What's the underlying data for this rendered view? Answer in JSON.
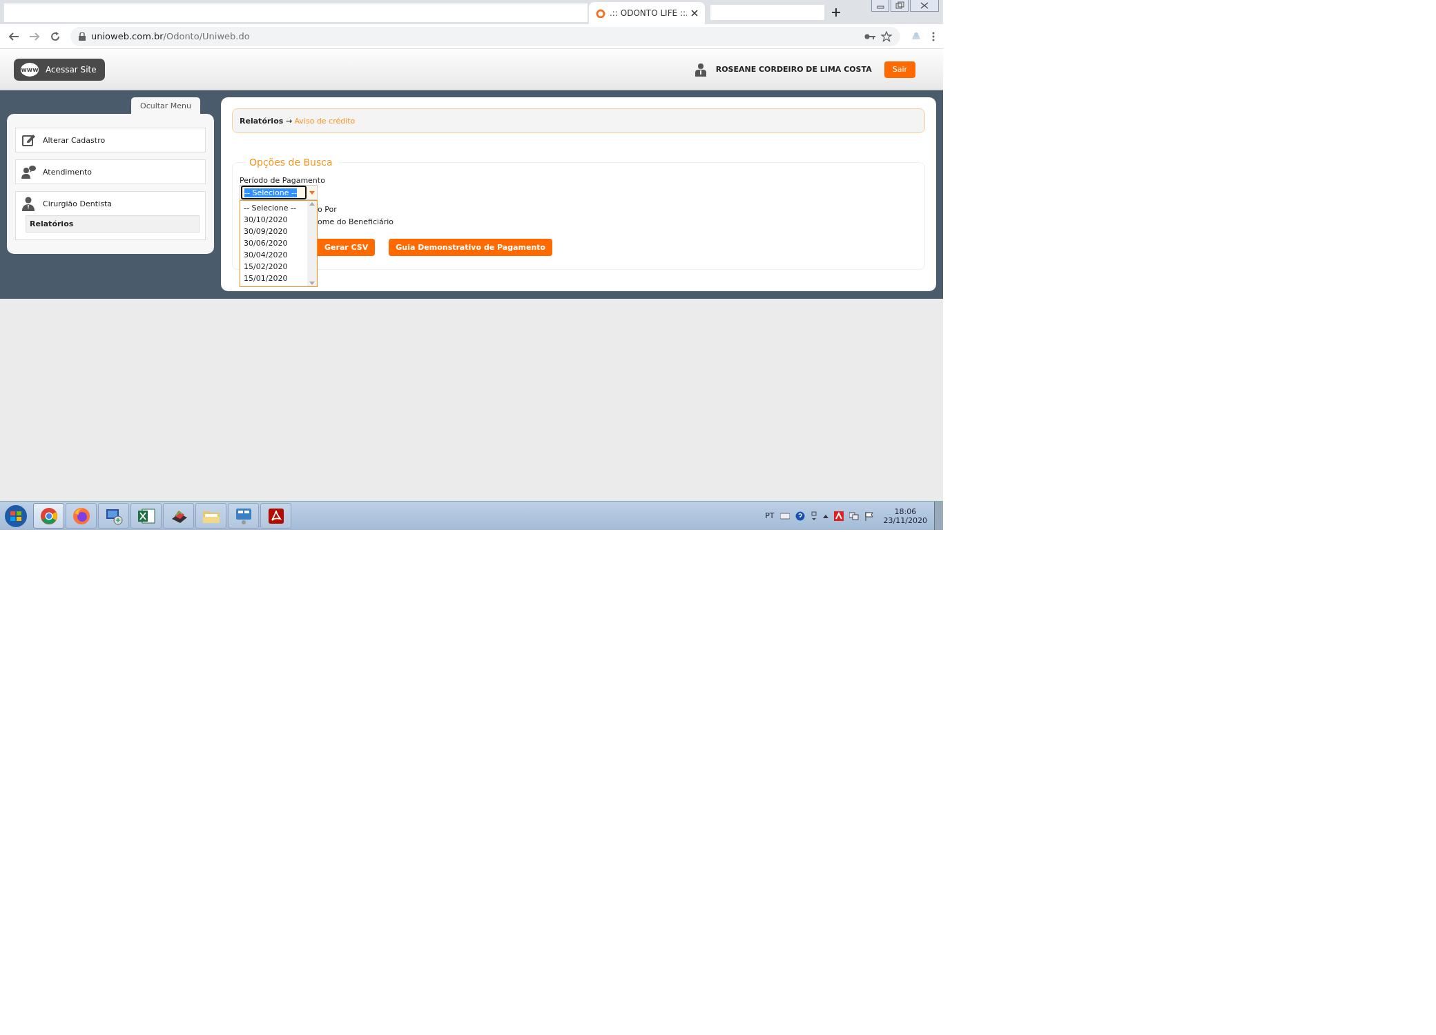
{
  "browser": {
    "tab_title": ".:: ODONTO LIFE ::.",
    "url_domain": "unioweb.com.br",
    "url_path": "/Odonto/Uniweb.do"
  },
  "header": {
    "www_badge": "www",
    "site_button": "Acessar Site",
    "user_name": "ROSEANE CORDEIRO DE LIMA COSTA",
    "logout_button": "Sair"
  },
  "sidebar": {
    "toggle": "Ocultar Menu",
    "items": [
      {
        "label": "Alterar Cadastro",
        "kind": "edit"
      },
      {
        "label": "Atendimento",
        "kind": "support"
      },
      {
        "label": "Cirurgião Dentista",
        "kind": "dentist",
        "children": [
          {
            "label": "Relatórios",
            "selected": true
          }
        ]
      }
    ]
  },
  "breadcrumb": {
    "section": "Relatórios",
    "separator": "→",
    "page": "Aviso de crédito"
  },
  "search": {
    "legend": "Opções de Busca",
    "period_label": "Período de Pagamento",
    "period_value": "-- Selecione --",
    "options": [
      "-- Selecione --",
      "30/10/2020",
      "30/09/2020",
      "30/06/2020",
      "30/04/2020",
      "15/02/2020",
      "15/01/2020"
    ],
    "sort_label": "o Por",
    "sort_option": "ome do Beneficiário",
    "buttons": [
      "Gerar CSV",
      "Guia Demonstrativo de Pagamento"
    ]
  },
  "taskbar": {
    "apps": [
      {
        "kind": "chrome",
        "selected": true
      },
      {
        "kind": "firefox",
        "selected": false
      },
      {
        "kind": "remote",
        "selected": false
      },
      {
        "kind": "excel",
        "selected": false
      },
      {
        "kind": "scanner",
        "selected": false
      },
      {
        "kind": "folder",
        "selected": false
      },
      {
        "kind": "network",
        "selected": false
      },
      {
        "kind": "pdf",
        "selected": false
      }
    ],
    "language": "PT",
    "time": "18:06",
    "date": "23/11/2020"
  }
}
